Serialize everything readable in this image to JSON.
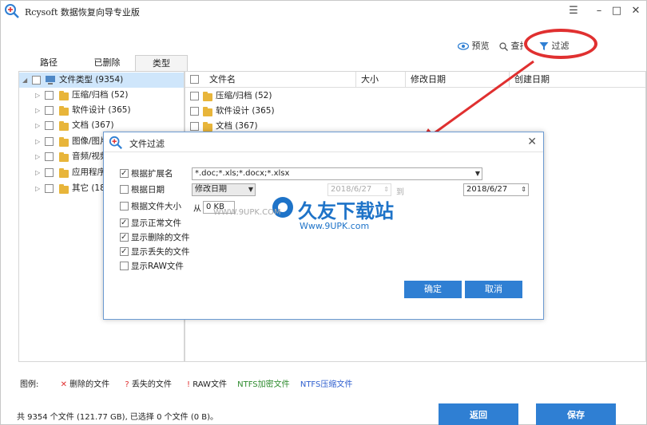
{
  "app": {
    "title": "Rcysoft 数据恢复向导专业版",
    "menu_icon": "☰",
    "minimize": "–",
    "maximize": "□",
    "close": "✕"
  },
  "toolbar": {
    "preview": "预览",
    "search": "查找",
    "filter": "过滤"
  },
  "tabs": [
    "路径",
    "已删除",
    "类型"
  ],
  "tree": {
    "root": "文件类型 (9354)",
    "items": [
      "压缩/归档 (52)",
      "软件设计 (365)",
      "文档 (367)",
      "图像/图片",
      "音频/视频",
      "应用程序",
      "其它 (18"
    ]
  },
  "columns": [
    "文件名",
    "大小",
    "修改日期",
    "创建日期"
  ],
  "files": [
    "压缩/归档 (52)",
    "软件设计 (365)",
    "文档 (367)"
  ],
  "dialog": {
    "title": "文件过滤",
    "by_ext": "根据扩展名",
    "ext_value": "*.doc;*.xls;*.docx;*.xlsx",
    "by_date": "根据日期",
    "date_type": "修改日期",
    "date_from": "2018/6/27",
    "date_to_label": "到",
    "date_to": "2018/6/27",
    "by_size": "根据文件大小",
    "size_from_label": "从",
    "size_value": "0 KB",
    "show_normal": "显示正常文件",
    "show_deleted": "显示删除的文件",
    "show_lost": "显示丢失的文件",
    "show_raw": "显示RAW文件",
    "ok": "确定",
    "cancel": "取消"
  },
  "watermark": {
    "brand": "久友下载站",
    "url_small": "WWW.9UPK.COM",
    "url": "Www.9UPK.com"
  },
  "legend": {
    "label": "图例:",
    "deleted": "删除的文件",
    "lost": "丢失的文件",
    "raw": "RAW文件",
    "ntfs_enc": "NTFS加密文件",
    "ntfs_comp": "NTFS压缩文件"
  },
  "status": "共 9354 个文件 (121.77 GB), 已选择 0 个文件 (0 B)。",
  "buttons": {
    "back": "返回",
    "save": "保存"
  },
  "colors": {
    "accent": "#2f7fd3",
    "highlight": "#e03030",
    "selection": "#cfe6fb"
  }
}
